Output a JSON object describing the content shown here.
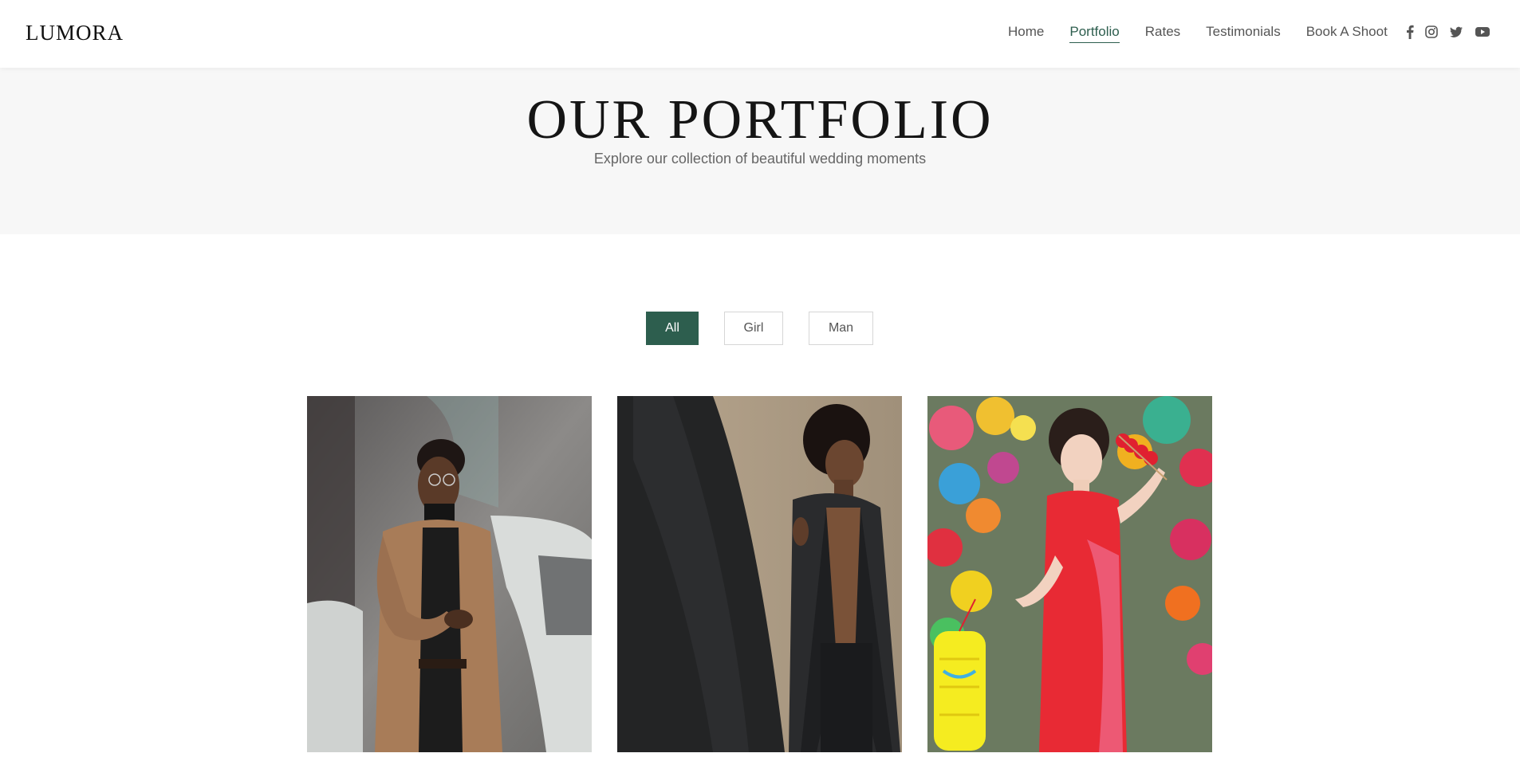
{
  "header": {
    "logo": "LUMORA",
    "nav": [
      {
        "label": "Home"
      },
      {
        "label": "Portfolio"
      },
      {
        "label": "Rates"
      },
      {
        "label": "Testimonials"
      },
      {
        "label": "Book A Shoot"
      }
    ],
    "active_nav": "Portfolio",
    "social_icons": [
      "facebook-icon",
      "instagram-icon",
      "twitter-icon",
      "youtube-icon"
    ]
  },
  "hero": {
    "title": "OUR PORTFOLIO",
    "subtitle": "Explore our collection of beautiful wedding moments"
  },
  "filters": {
    "items": [
      {
        "label": "All"
      },
      {
        "label": "Girl"
      },
      {
        "label": "Man"
      }
    ],
    "selected": "All"
  },
  "gallery": {
    "photos": [
      {
        "subject": "man in camel coat holding phone beside white car"
      },
      {
        "subject": "shirtless man in dark robe against stone wall"
      },
      {
        "subject": "woman in red qipao holding candied fruit and yellow lantern"
      }
    ]
  },
  "colors": {
    "accent": "#2d5e4e",
    "hero_bg": "#f7f7f7",
    "text": "#555555"
  }
}
